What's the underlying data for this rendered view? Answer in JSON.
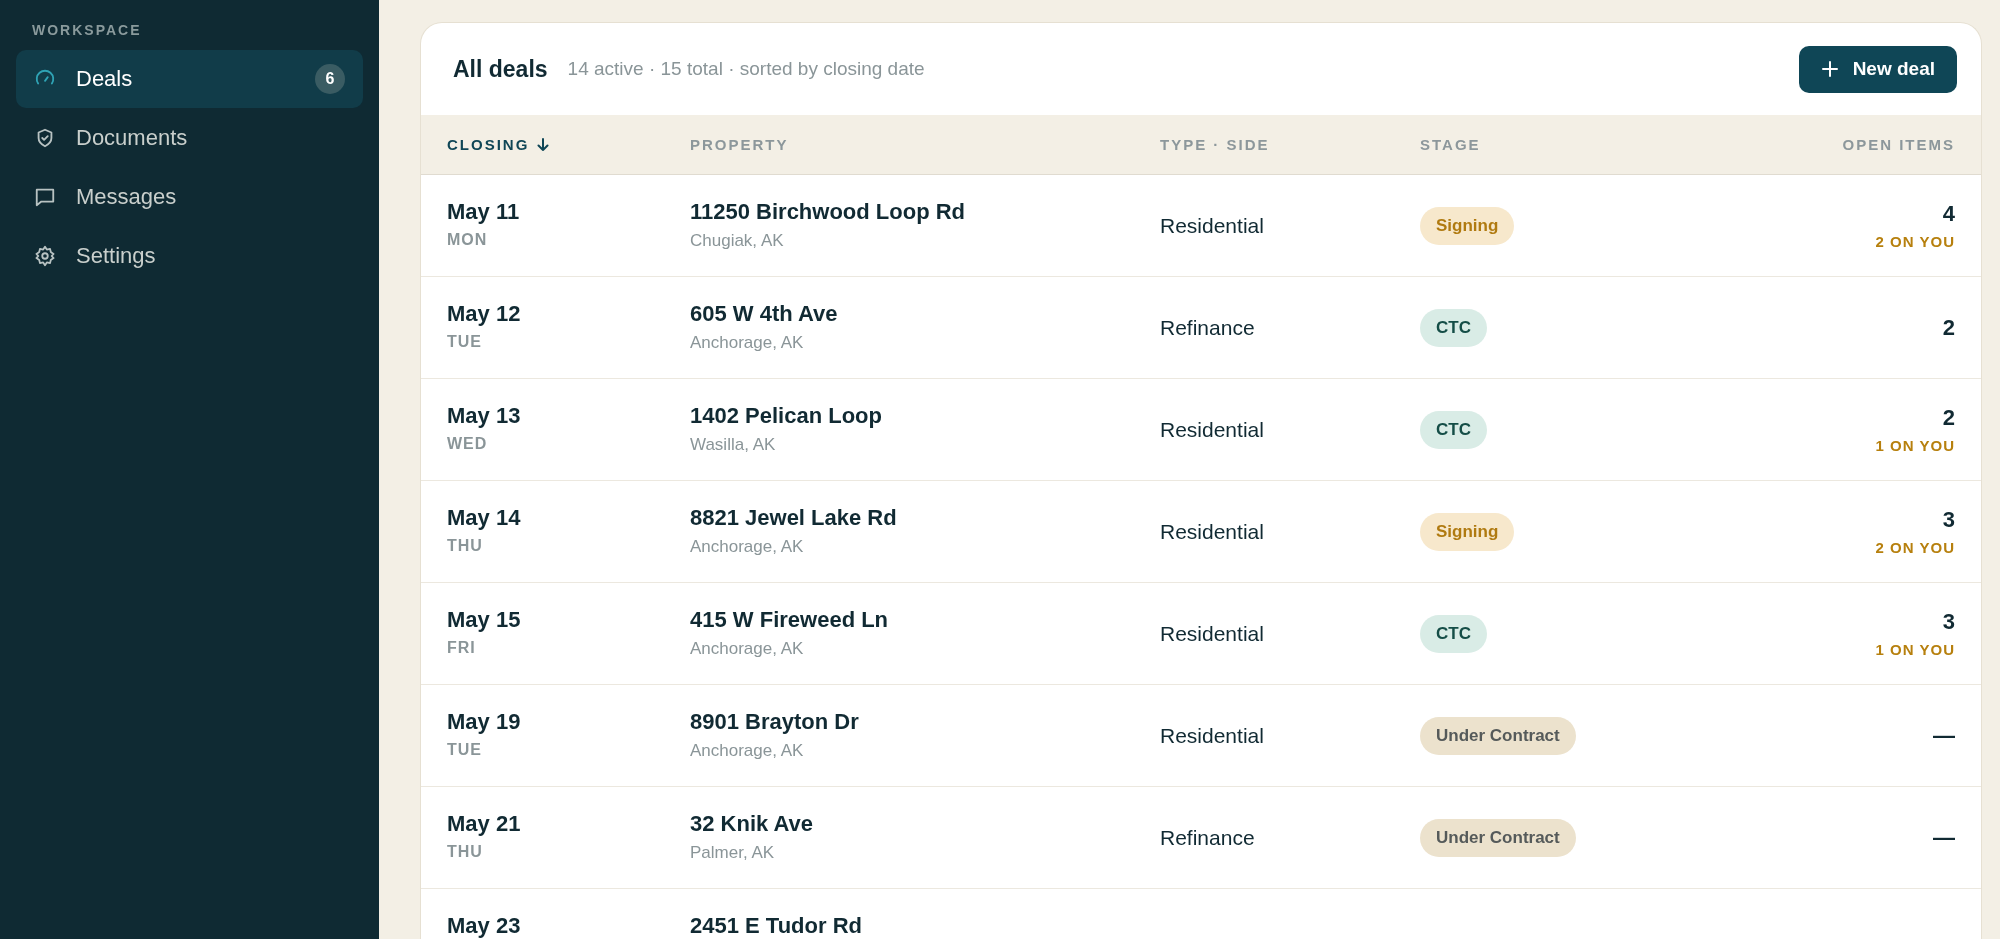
{
  "sidebar": {
    "section_label": "WORKSPACE",
    "items": [
      {
        "label": "Deals",
        "badge": "6",
        "selected": true
      },
      {
        "label": "Documents",
        "selected": false
      },
      {
        "label": "Messages",
        "selected": false
      },
      {
        "label": "Settings",
        "selected": false
      }
    ]
  },
  "header": {
    "title": "All deals",
    "summary": "14 active · 15 total · sorted by closing date",
    "new_button": "New deal"
  },
  "table": {
    "columns": [
      {
        "label": "CLOSING",
        "sorted": true
      },
      {
        "label": "PROPERTY",
        "sorted": false
      },
      {
        "label": "TYPE · SIDE",
        "sorted": false
      },
      {
        "label": "STAGE",
        "sorted": false
      },
      {
        "label": "OPEN ITEMS",
        "sorted": false
      }
    ],
    "rows": [
      {
        "date": "May 11",
        "weekday": "MON",
        "address": "11250 Birchwood Loop Rd",
        "city": "Chugiak, AK",
        "type": "Residential",
        "stage": {
          "label": "Signing",
          "kind": "signing"
        },
        "open_items": "4",
        "on_you": "2 ON YOU"
      },
      {
        "date": "May 12",
        "weekday": "TUE",
        "address": "605 W 4th Ave",
        "city": "Anchorage, AK",
        "type": "Refinance",
        "stage": {
          "label": "CTC",
          "kind": "ctc"
        },
        "open_items": "2"
      },
      {
        "date": "May 13",
        "weekday": "WED",
        "address": "1402 Pelican Loop",
        "city": "Wasilla, AK",
        "type": "Residential",
        "stage": {
          "label": "CTC",
          "kind": "ctc"
        },
        "open_items": "2",
        "on_you": "1 ON YOU"
      },
      {
        "date": "May 14",
        "weekday": "THU",
        "address": "8821 Jewel Lake Rd",
        "city": "Anchorage, AK",
        "type": "Residential",
        "stage": {
          "label": "Signing",
          "kind": "signing"
        },
        "open_items": "3",
        "on_you": "2 ON YOU"
      },
      {
        "date": "May 15",
        "weekday": "FRI",
        "address": "415 W Fireweed Ln",
        "city": "Anchorage, AK",
        "type": "Residential",
        "stage": {
          "label": "CTC",
          "kind": "ctc"
        },
        "open_items": "3",
        "on_you": "1 ON YOU"
      },
      {
        "date": "May 19",
        "weekday": "TUE",
        "address": "8901 Brayton Dr",
        "city": "Anchorage, AK",
        "type": "Residential",
        "stage": {
          "label": "Under Contract",
          "kind": "contract"
        },
        "open_items": "—"
      },
      {
        "date": "May 21",
        "weekday": "THU",
        "address": "32 Knik Ave",
        "city": "Palmer, AK",
        "type": "Refinance",
        "stage": {
          "label": "Under Contract",
          "kind": "contract"
        },
        "open_items": "—"
      },
      {
        "date": "May 23",
        "address": "2451 E Tudor Rd"
      }
    ]
  }
}
